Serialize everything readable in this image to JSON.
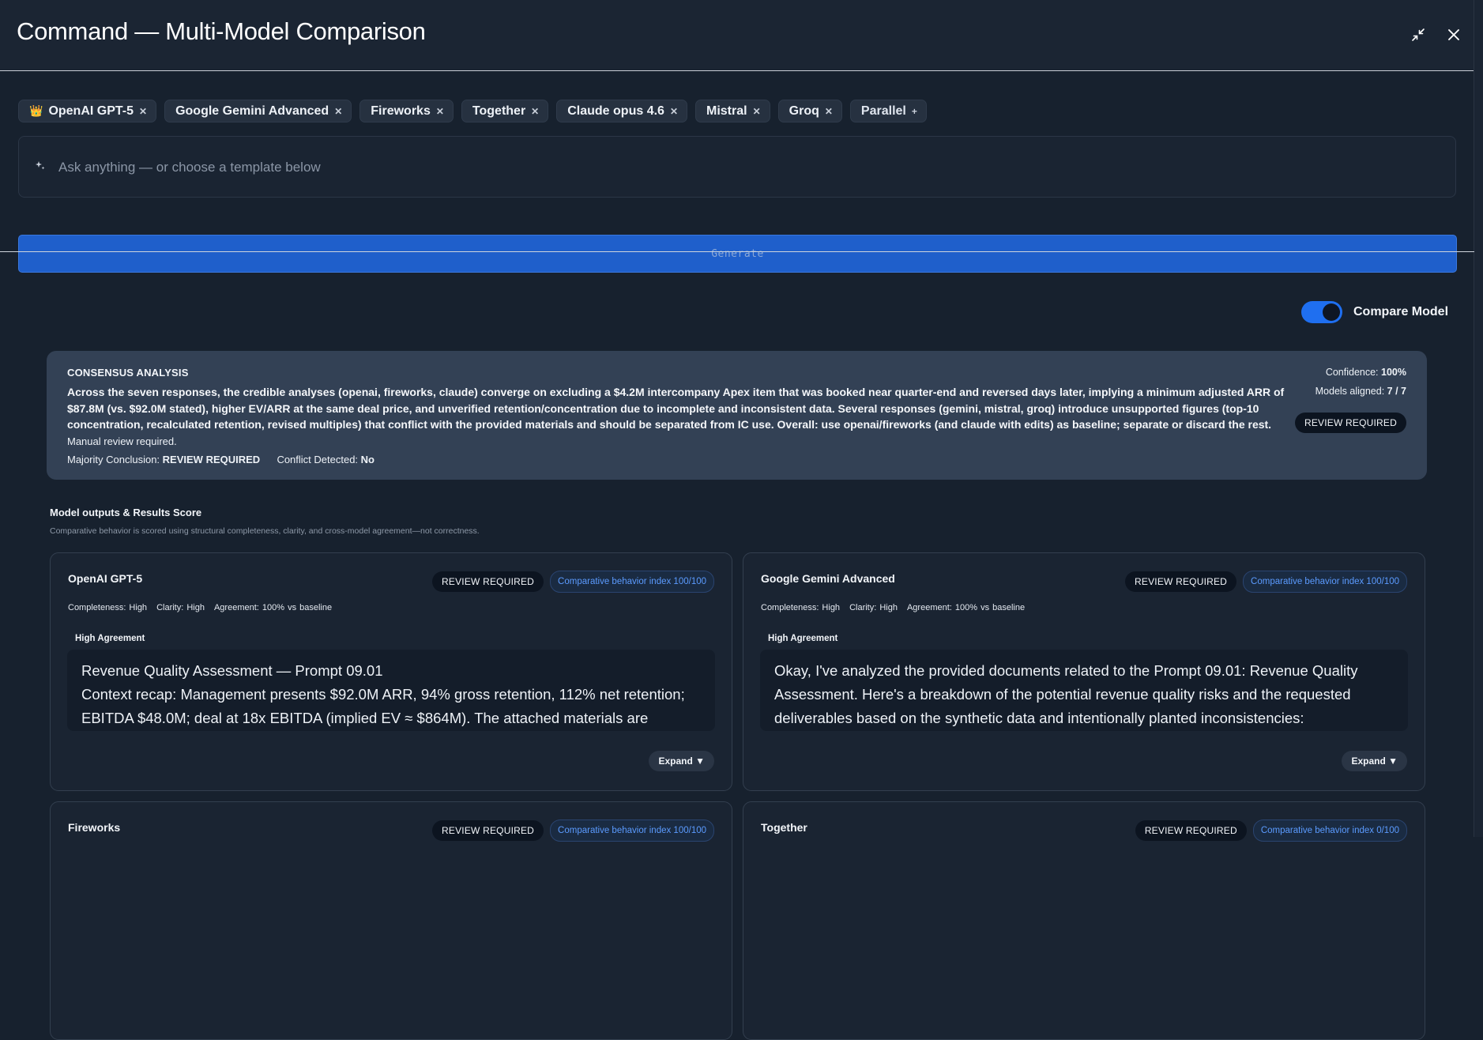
{
  "header": {
    "title": "Command — Multi-Model Comparison"
  },
  "models": [
    {
      "label": "OpenAI GPT-5",
      "icon": "crown-icon"
    },
    {
      "label": "Google Gemini Advanced"
    },
    {
      "label": "Fireworks"
    },
    {
      "label": "Together"
    },
    {
      "label": "Claude opus 4.6"
    },
    {
      "label": "Mistral"
    },
    {
      "label": "Groq"
    }
  ],
  "parallel_label": "Parallel",
  "prompt": {
    "placeholder": "Ask anything — or choose a template below"
  },
  "generate_label": "Generate",
  "compare_toggle": {
    "label": "Compare Model",
    "on": true
  },
  "consensus": {
    "heading": "CONSENSUS ANALYSIS",
    "body": "Across the seven responses, the credible analyses (openai, fireworks, claude) converge on excluding a $4.2M intercompany Apex item that was booked near quarter-end and reversed days later, implying a minimum adjusted ARR of $87.8M (vs. $92.0M stated), higher EV/ARR at the same deal price, and unverified retention/concentration due to incomplete and inconsistent data. Several responses (gemini, mistral, groq) introduce unsupported figures (top-10 concentration, recalculated retention, revised multiples) that conflict with the provided materials and should be separated from IC use. Overall: use openai/fireworks (and claude with edits) as baseline; separate or discard the rest.",
    "manual": "Manual review required.",
    "majority_label": "Majority Conclusion:",
    "majority_value": "REVIEW REQUIRED",
    "conflict_label": "Conflict Detected:",
    "conflict_value": "No",
    "confidence_label": "Confidence:",
    "confidence_value": "100%",
    "aligned_label": "Models aligned:",
    "aligned_value": "7 / 7",
    "status_badge": "REVIEW REQUIRED"
  },
  "results": {
    "title": "Model outputs & Results Score",
    "subtitle": "Comparative behavior is scored using structural completeness, clarity, and cross-model agreement—not correctness."
  },
  "cards": [
    {
      "name": "OpenAI GPT-5",
      "status": "REVIEW REQUIRED",
      "index": "Comparative behavior index 100/100",
      "completeness": "Completeness: High",
      "clarity": "Clarity: High",
      "agreement": "Agreement: 100% vs baseline",
      "agreement_level": "High Agreement",
      "text": "Revenue Quality Assessment — Prompt 09.01\nContext recap: Management presents $92.0M ARR, 94% gross retention, 112% net retention; EBITDA $48.0M; deal at 18x EBITDA (implied EV ≈ $864M). The attached materials are synthetic",
      "expand": "Expand ▼"
    },
    {
      "name": "Google Gemini Advanced",
      "status": "REVIEW REQUIRED",
      "index": "Comparative behavior index 100/100",
      "completeness": "Completeness: High",
      "clarity": "Clarity: High",
      "agreement": "Agreement: 100% vs baseline",
      "agreement_level": "High Agreement",
      "text": "Okay, I've analyzed the provided documents related to the Prompt 09.01: Revenue Quality Assessment. Here's a breakdown of the potential revenue quality risks and the requested deliverables based on the synthetic data and intentionally planted inconsistencies:",
      "expand": "Expand ▼"
    },
    {
      "name": "Fireworks",
      "status": "REVIEW REQUIRED",
      "index": "Comparative behavior index 100/100"
    },
    {
      "name": "Together",
      "status": "REVIEW REQUIRED",
      "index": "Comparative behavior index 0/100"
    }
  ]
}
